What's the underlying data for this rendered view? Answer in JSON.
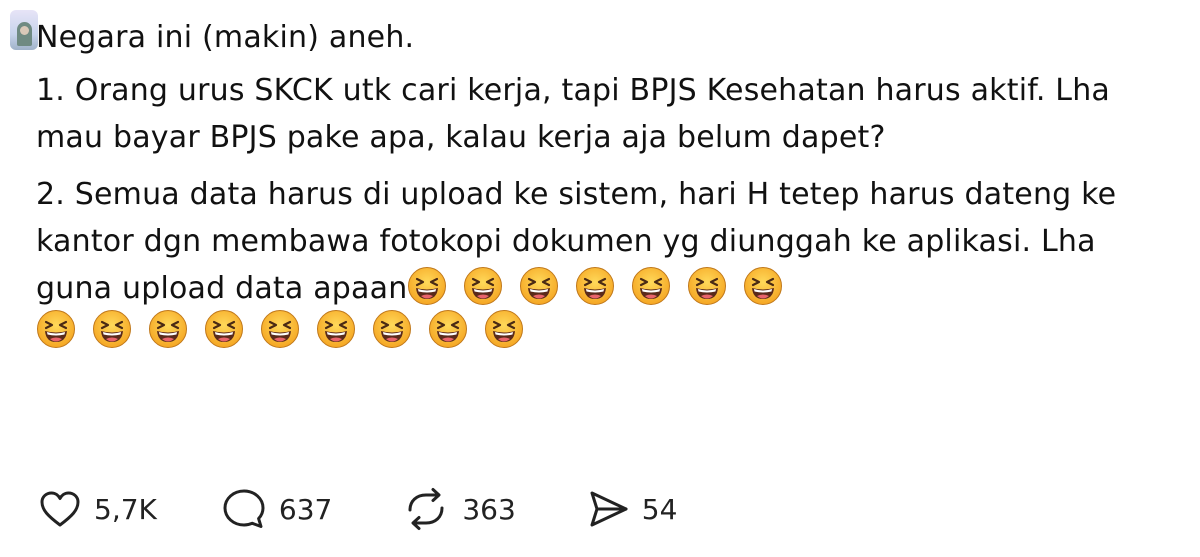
{
  "post": {
    "line1": "Negara ini (makin) aneh.",
    "point1": "1. Orang urus SKCK utk cari kerja, tapi BPJS Kesehatan harus aktif. Lha mau bayar BPJS pake apa, kalau kerja aja belum dapet?",
    "point2": "2. Semua data harus di upload ke sistem, hari H tetep harus dateng ke kantor dgn membawa fotokopi dokumen yg diunggah ke aplikasi. Lha guna upload data apaan",
    "emoji_icon": "grinning-squinting-face-icon",
    "emoji_count": 16
  },
  "actions": {
    "like_count": "5,7K",
    "reply_count": "637",
    "repost_count": "363",
    "share_count": "54",
    "icon_color": "#222222"
  },
  "colors": {
    "emoji_face": "#f7b52a",
    "emoji_outline": "#c0781a",
    "emoji_mouth": "#5a2a1a"
  }
}
